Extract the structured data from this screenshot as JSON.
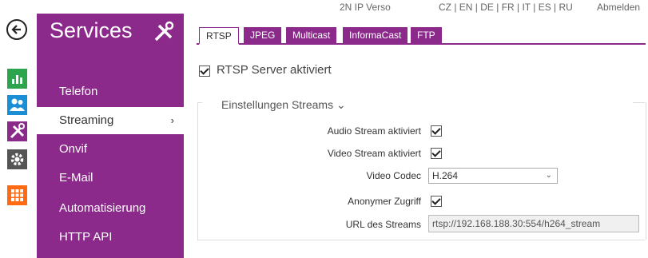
{
  "topbar": {
    "device": "2N IP Verso",
    "languages": "CZ | EN | DE | FR | IT | ES | RU",
    "logout": "Abmelden"
  },
  "sidebar": {
    "title": "Services",
    "items": [
      {
        "label": "Telefon"
      },
      {
        "label": "Streaming",
        "active": true
      },
      {
        "label": "Onvif"
      },
      {
        "label": "E-Mail"
      },
      {
        "label": "Automatisierung"
      },
      {
        "label": "HTTP API"
      }
    ]
  },
  "tabs": [
    {
      "label": "RTSP",
      "active": true
    },
    {
      "label": "JPEG"
    },
    {
      "label": "Multicast"
    },
    {
      "label": "InformaCast"
    },
    {
      "label": "FTP"
    }
  ],
  "main": {
    "rtsp_server_label": "RTSP Server aktiviert",
    "rtsp_server_checked": true,
    "section_title": "Einstellungen Streams ⌄",
    "fields": {
      "audio_label": "Audio Stream aktiviert",
      "audio_checked": true,
      "video_label": "Video Stream aktiviert",
      "video_checked": true,
      "codec_label": "Video Codec",
      "codec_value": "H.264",
      "anon_label": "Anonymer Zugriff",
      "anon_checked": true,
      "url_label": "URL des Streams",
      "url_value": "rtsp://192.168.188.30:554/h264_stream"
    }
  },
  "colors": {
    "brand": "#8b2a8b",
    "stats": "#2da44e",
    "users": "#1b8fd6",
    "apps": "#ff6a13"
  }
}
